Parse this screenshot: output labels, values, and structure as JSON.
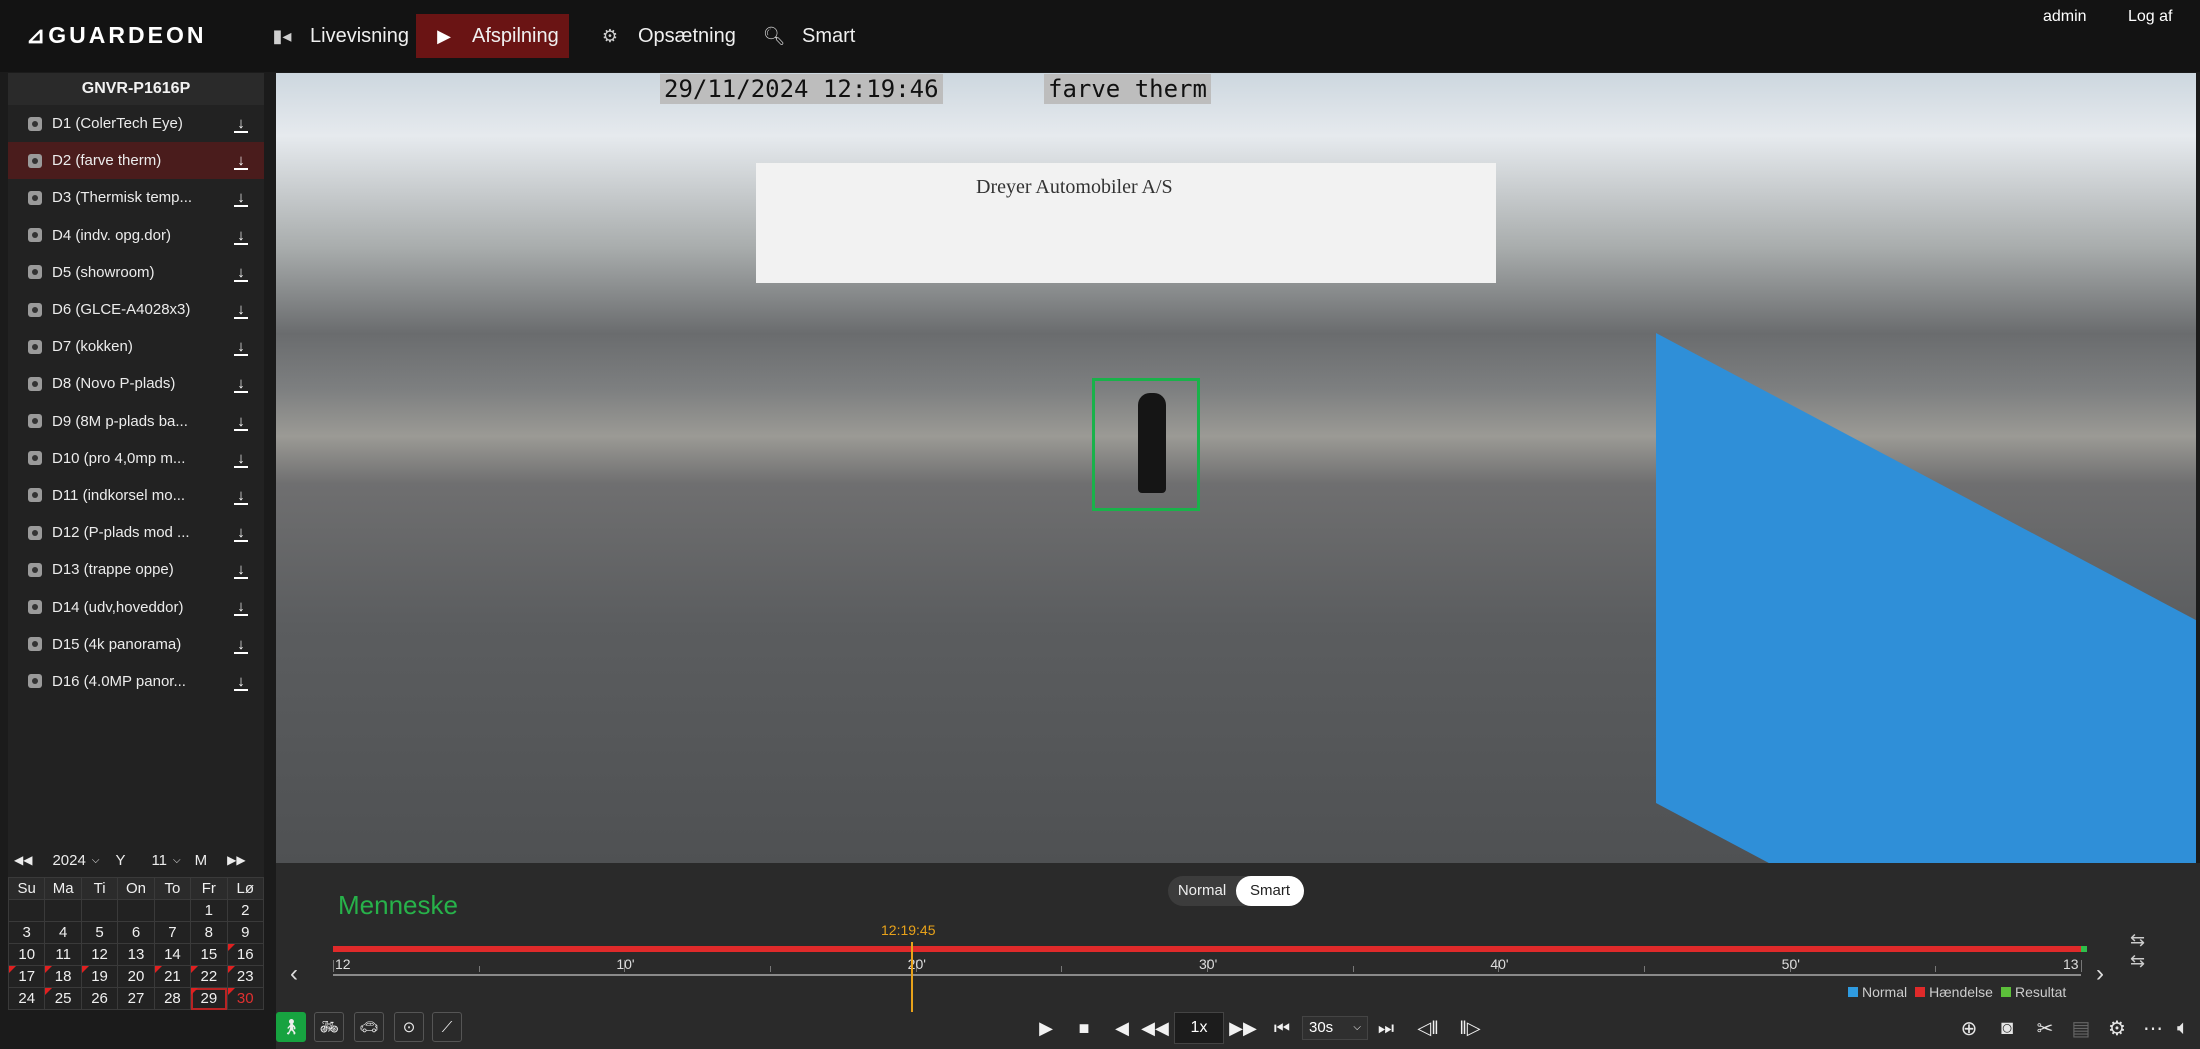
{
  "app": {
    "logo": "GUARDEON",
    "user": "admin",
    "logout": "Log af"
  },
  "nav": [
    {
      "label": "Livevisning",
      "icon": "camera-icon"
    },
    {
      "label": "Afspilning",
      "icon": "play-icon",
      "active": true
    },
    {
      "label": "Opsætning",
      "icon": "gear-icon"
    },
    {
      "label": "Smart",
      "icon": "search-icon"
    }
  ],
  "device": {
    "name": "GNVR-P1616P"
  },
  "channels": [
    "D1 (ColerTech Eye)",
    "D2 (farve therm)",
    "D3 (Thermisk temp...",
    "D4 (indv. opg.dor)",
    "D5 (showroom)",
    "D6 (GLCE-A4028x3)",
    "D7 (kokken)",
    "D8 (Novo P-plads)",
    "D9 (8M p-plads ba...",
    "D10 (pro 4,0mp m...",
    "D11 (indkorsel mo...",
    "D12 (P-plads mod ...",
    "D13 (trappe oppe)",
    "D14 (udv,hoveddor)",
    "D15 (4k panorama)",
    "D16 (4.0MP panor..."
  ],
  "calendar": {
    "year": "2024",
    "year_unit": "Y",
    "month": "11",
    "month_unit": "M",
    "weekdays": [
      "Su",
      "Ma",
      "Ti",
      "On",
      "To",
      "Fr",
      "Lø"
    ],
    "rows": [
      [
        "",
        "",
        "",
        "",
        "",
        "1",
        "2"
      ],
      [
        "3",
        "4",
        "5",
        "6",
        "7",
        "8",
        "9"
      ],
      [
        "10",
        "11",
        "12",
        "13",
        "14",
        "15",
        "16"
      ],
      [
        "17",
        "18",
        "19",
        "20",
        "21",
        "22",
        "23"
      ],
      [
        "24",
        "25",
        "26",
        "27",
        "28",
        "29",
        "30"
      ]
    ]
  },
  "video": {
    "osd_datetime": "29/11/2024 12:19:46",
    "osd_name": "farve therm",
    "sign": "Dreyer Automobiler A/S"
  },
  "playback": {
    "mode_normal": "Normal",
    "mode_smart": "Smart",
    "detection_label": "Menneske",
    "cursor_time": "12:19:45",
    "timeline_labels": [
      "12",
      "10'",
      "20'",
      "30'",
      "40'",
      "50'",
      "13"
    ],
    "speed": "1x",
    "step": "30s",
    "legend": [
      {
        "label": "Normal",
        "color": "#2f9be0"
      },
      {
        "label": "Hændelse",
        "color": "#e02a2a"
      },
      {
        "label": "Resultat",
        "color": "#5cbf3a"
      }
    ]
  },
  "colors": {
    "accent_active": "#6a1414",
    "detection": "#27b24a",
    "timeline_red": "#e02a2a",
    "cursor": "#e8a21a"
  }
}
